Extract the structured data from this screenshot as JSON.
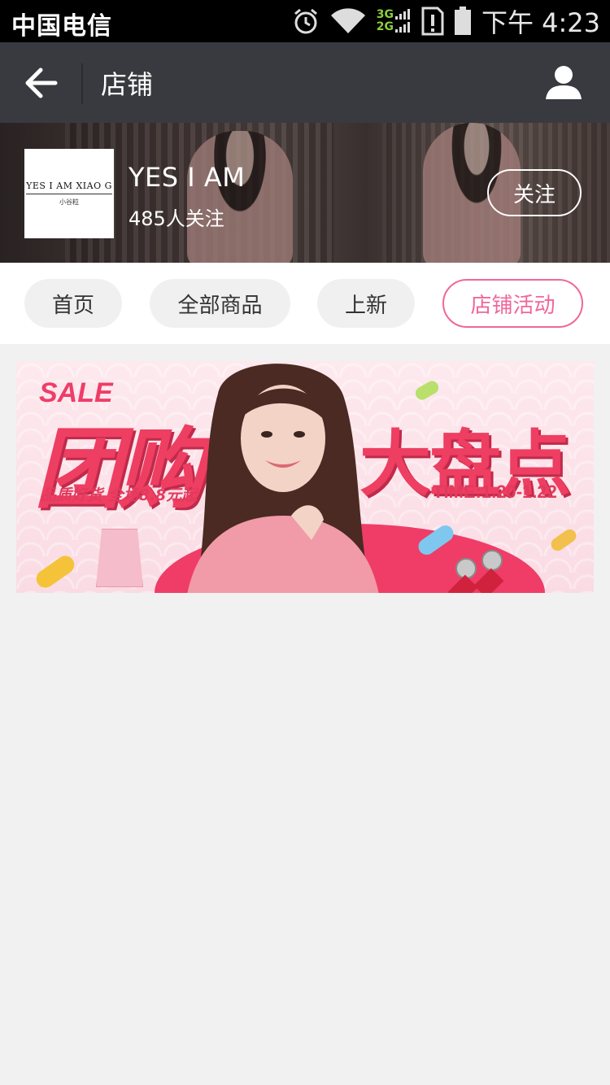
{
  "status_bar": {
    "carrier": "中国电信",
    "network_labels": [
      "3G",
      "2G"
    ],
    "time": "下午 4:23",
    "icons": [
      "alarm-icon",
      "wifi-icon",
      "signal-icon",
      "sim-alert-icon",
      "battery-icon"
    ]
  },
  "header": {
    "title": "店铺",
    "back_icon": "back-arrow-icon",
    "user_icon": "user-icon",
    "background": "#393a3f"
  },
  "shop": {
    "logo_text": "YES I AM XIAO G",
    "logo_subtext": "小谷粒",
    "name": "YES I AM",
    "followers": "485人关注",
    "follow_label": "关注"
  },
  "tabs": [
    {
      "label": "首页",
      "active": false
    },
    {
      "label": "全部商品",
      "active": false
    },
    {
      "label": "上新",
      "active": false
    },
    {
      "label": "店铺活动",
      "active": true
    }
  ],
  "promo_banner": {
    "sale_text": "SALE",
    "headline_left": "团购",
    "tagline": "品质好货 全场8.8元起",
    "headline_right": "大盘点",
    "time_text": "TIME:1.20-1.22"
  },
  "colors": {
    "accent": "#f0679a",
    "promo_red": "#ee3e62",
    "page_bg": "#f1f1f1"
  }
}
